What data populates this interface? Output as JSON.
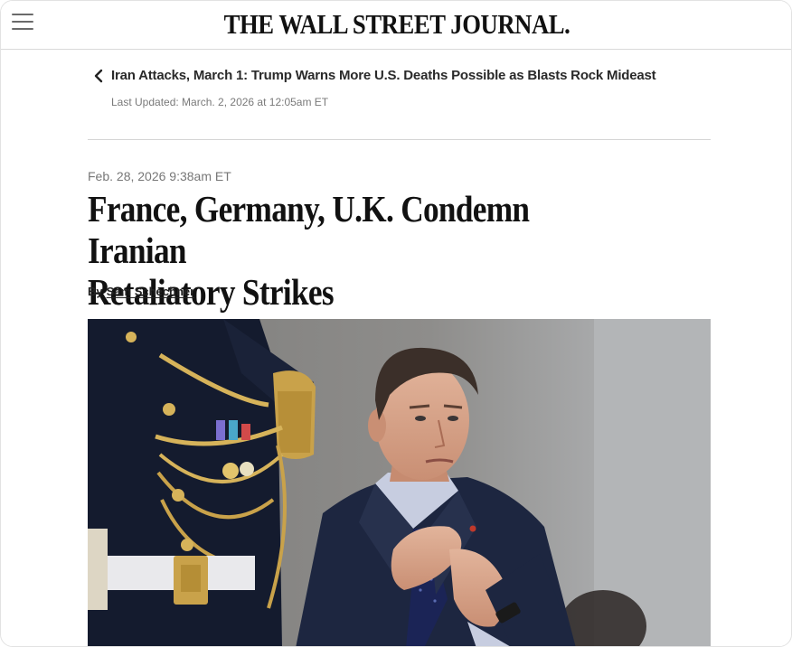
{
  "header": {
    "masthead": "THE WALL STREET JOURNAL.",
    "menu_icon": "hamburger-menu-icon"
  },
  "breadcrumb": {
    "icon": "chevron-left-icon",
    "text": "Iran Attacks, March 1: Trump Warns More U.S. Deaths Possible as Blasts Rock Mideast",
    "updated": "Last Updated: March. 2, 2026 at 12:05am ET"
  },
  "article": {
    "timestamp": "Feb. 28, 2026 9:38am ET",
    "headline_line1": "France, Germany, U.K. Condemn Iranian",
    "headline_line2": "Retaliatory Strikes",
    "by_label": "By",
    "author": "Sam Schechner"
  },
  "photo": {
    "subject": "man in dark suit adjusting tie beside ceremonial guard"
  },
  "colors": {
    "text": "#111111",
    "muted": "#777777",
    "divider": "#d4d4d4",
    "suit": "#1f2a44",
    "gold": "#c9a24a",
    "background_wall": "#8f8e8c"
  }
}
